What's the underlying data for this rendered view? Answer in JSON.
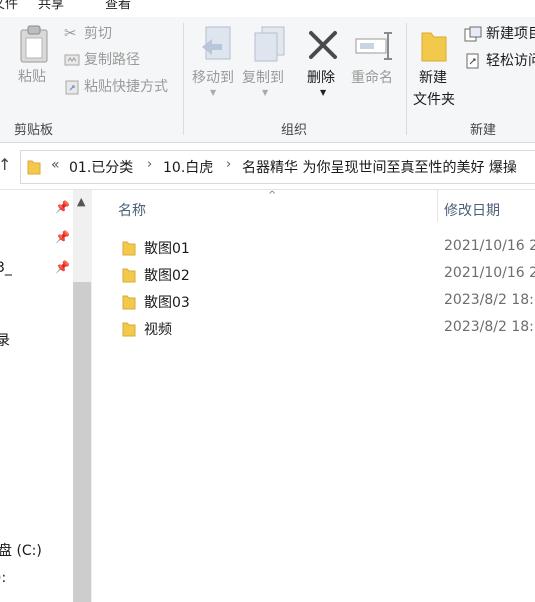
{
  "ribbon_tabs": [
    "文件",
    "共享",
    "查看"
  ],
  "ribbon": {
    "clipboard": {
      "paste": "粘贴",
      "cut": "剪切",
      "copy_path": "复制路径",
      "paste_shortcut": "粘贴快捷方式",
      "group": "剪贴板"
    },
    "organize": {
      "move_to": "移动到",
      "copy_to": "复制到",
      "delete": "删除",
      "rename": "重命名",
      "group": "组织"
    },
    "new": {
      "new_folder_line1": "新建",
      "new_folder_line2": "文件夹",
      "new_item": "新建项目",
      "easy_access": "轻松访问",
      "group": "新建"
    }
  },
  "address": {
    "prefix": "«",
    "crumbs": [
      "01.已分类",
      "10.白虎",
      "名器精华 为你呈现世间至真至性的美好 爆操"
    ]
  },
  "nav": {
    "items": [
      "3_",
      "录",
      "盘 (C:)",
      "):"
    ]
  },
  "columns": {
    "name": "名称",
    "date": "修改日期"
  },
  "files": [
    {
      "name": "散图01",
      "date": "2021/10/16 2"
    },
    {
      "name": "散图02",
      "date": "2021/10/16 2"
    },
    {
      "name": "散图03",
      "date": "2023/8/2 18:"
    },
    {
      "name": "视频",
      "date": "2023/8/2 18:"
    }
  ],
  "colors": {
    "folder": "#f3c94c",
    "header_text": "#4c607a",
    "date_text": "#6d6d6d"
  }
}
